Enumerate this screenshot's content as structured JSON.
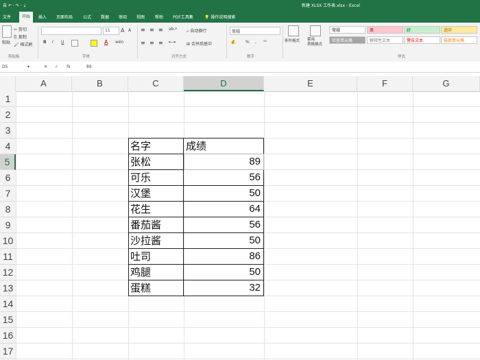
{
  "title_bar": {
    "left": "自 ↶ · ↷ · ⇣",
    "title": "新建 XLSX 工作表.xlsx - Excel"
  },
  "tabs": [
    "文件",
    "开始",
    "插入",
    "页面布局",
    "公式",
    "数据",
    "审阅",
    "视图",
    "帮助",
    "PDF工具集",
    "操作说明搜索"
  ],
  "ribbon": {
    "clipboard": {
      "paste": "粘贴",
      "cut": "剪切",
      "copy": "复制",
      "format_painter": "格式刷",
      "label": "剪贴板"
    },
    "font": {
      "font_name": "",
      "font_size": "11",
      "bold": "B",
      "italic": "I",
      "underline": "U",
      "grow": "A",
      "shrink": "A",
      "phonetic": "wén",
      "label": "字体"
    },
    "alignment": {
      "wrap": "自动换行",
      "merge": "合并后居中",
      "label": "对齐方式"
    },
    "number": {
      "format": "常规",
      "percent": "%",
      "comma": ",",
      "label": "数字"
    },
    "styles": {
      "conditional": "条件格式",
      "table": "套用\n表格格式",
      "cells": [
        {
          "text": "常规",
          "bg": "#ffffff",
          "color": "#222222"
        },
        {
          "text": "差",
          "bg": "#ffc7ce",
          "color": "#9c0006"
        },
        {
          "text": "好",
          "bg": "#c6efce",
          "color": "#006100"
        },
        {
          "text": "适中",
          "bg": "#ffeb9c",
          "color": "#9c5700"
        },
        {
          "text": "检查单元格",
          "bg": "#a5a5a5",
          "color": "#ffffff"
        },
        {
          "text": "解释性文本",
          "bg": "#ffffff",
          "color": "#7f7f7f"
        },
        {
          "text": "警告文本",
          "bg": "#ffffff",
          "color": "#ff0000"
        },
        {
          "text": "链接单元格",
          "bg": "#ffffff",
          "color": "#fa7d00"
        }
      ],
      "label": "样式"
    }
  },
  "formula_bar": {
    "name_box": "D5",
    "fx": "fx",
    "value": "89"
  },
  "columns": [
    "A",
    "B",
    "C",
    "D",
    "E",
    "F",
    "G"
  ],
  "rows": [
    "1",
    "2",
    "3",
    "4",
    "5",
    "6",
    "7",
    "8",
    "9",
    "10",
    "11",
    "12",
    "13",
    "14",
    "15",
    "16",
    "17"
  ],
  "selected": {
    "column": "D",
    "row": "5"
  },
  "table": {
    "headers": [
      "名字",
      "成绩"
    ],
    "rows": [
      [
        "张松",
        "89"
      ],
      [
        "可乐",
        "56"
      ],
      [
        "汉堡",
        "50"
      ],
      [
        "花生",
        "64"
      ],
      [
        "番茄酱",
        "56"
      ],
      [
        "沙拉酱",
        "50"
      ],
      [
        "吐司",
        "86"
      ],
      [
        "鸡腿",
        "50"
      ],
      [
        "蛋糕",
        "32"
      ]
    ]
  },
  "colors": {
    "accent": "#217346",
    "grid": "#e3e3e3",
    "header_bg": "#f3f3f3"
  }
}
